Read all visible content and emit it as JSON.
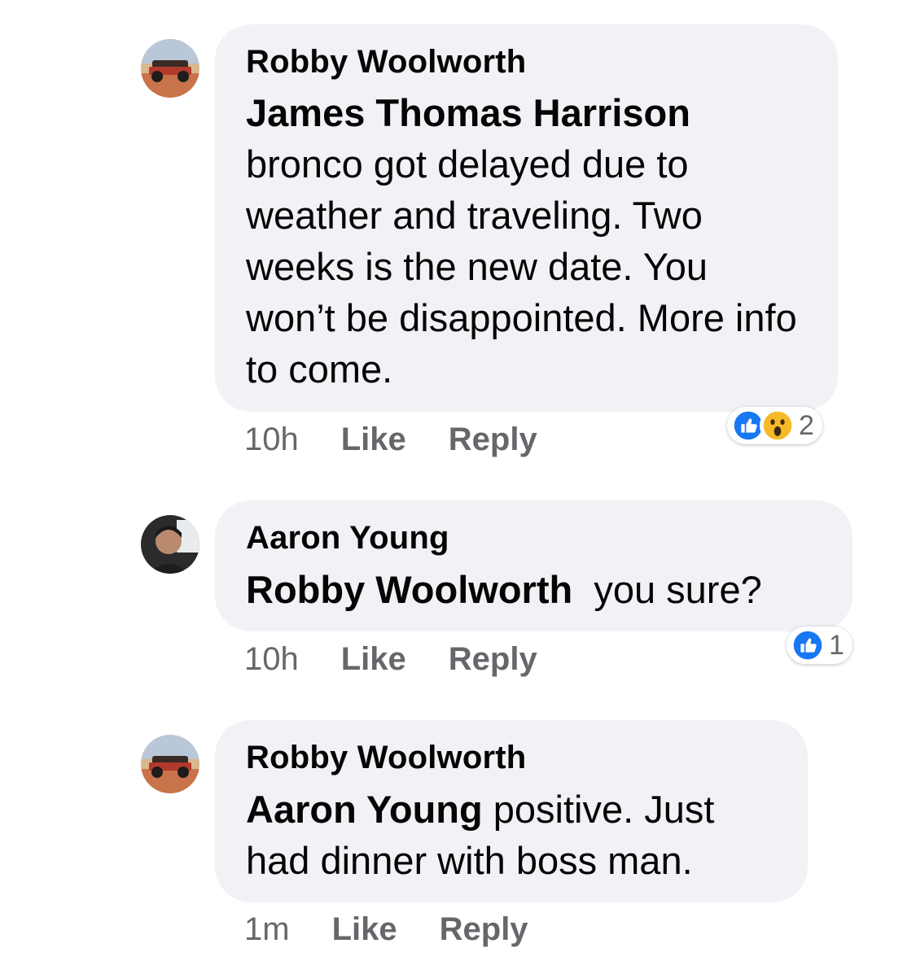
{
  "comments": [
    {
      "author": "Robby Woolworth",
      "mention": "James Thomas Harrison",
      "text": "bronco got delayed due to weather and traveling. Two weeks is the new date. You won’t be disappointed. More info to come.",
      "time": "10h",
      "like_label": "Like",
      "reply_label": "Reply",
      "reactions": [
        "like",
        "wow"
      ],
      "reaction_count": "2"
    },
    {
      "author": "Aaron Young",
      "mention": "Robby Woolworth",
      "text": "you sure?",
      "time": "10h",
      "like_label": "Like",
      "reply_label": "Reply",
      "reactions": [
        "like"
      ],
      "reaction_count": "1"
    },
    {
      "author": "Robby Woolworth",
      "mention": "Aaron Young",
      "text": "positive. Just had dinner with boss man.",
      "time": "1m",
      "like_label": "Like",
      "reply_label": "Reply"
    }
  ],
  "colors": {
    "bubble": "#f0f2f5",
    "meta": "#65676b",
    "like_blue": "#1877f2"
  }
}
